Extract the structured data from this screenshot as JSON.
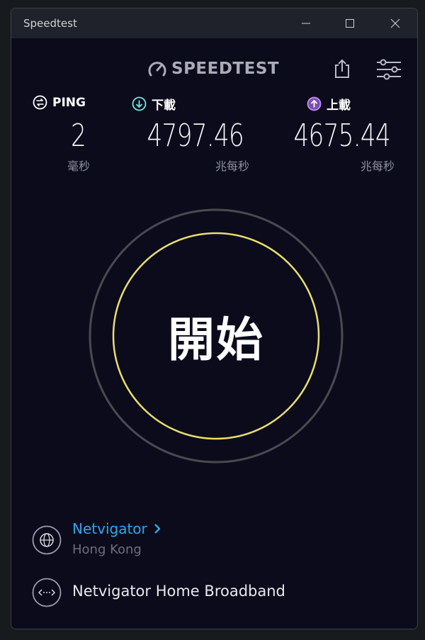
{
  "window": {
    "title": "Speedtest"
  },
  "header": {
    "logo_text": "SPEEDTEST"
  },
  "metrics": {
    "ping": {
      "label": "PING",
      "value": "2",
      "unit": "毫秒"
    },
    "download": {
      "label": "下載",
      "value": "4797.46",
      "unit": "兆每秒"
    },
    "upload": {
      "label": "上載",
      "value": "4675.44",
      "unit": "兆每秒"
    }
  },
  "go_button": {
    "label": "開始"
  },
  "isp": {
    "name": "Netvigator",
    "location": "Hong Kong"
  },
  "server": {
    "name": "Netvigator Home Broadband"
  },
  "colors": {
    "background": "#0b0b1c",
    "ping_icon": "#ffffff",
    "download_icon": "#6ee8dc",
    "upload_icon": "#c58cf5",
    "ring_outer": "#4a4a4e",
    "ring_inner": "#e8dd6c",
    "isp_link": "#2da8e8"
  },
  "icons": [
    "ping-icon",
    "download-icon",
    "upload-icon",
    "share-icon",
    "settings-icon",
    "globe-icon",
    "server-icon",
    "chevron-right-icon"
  ]
}
